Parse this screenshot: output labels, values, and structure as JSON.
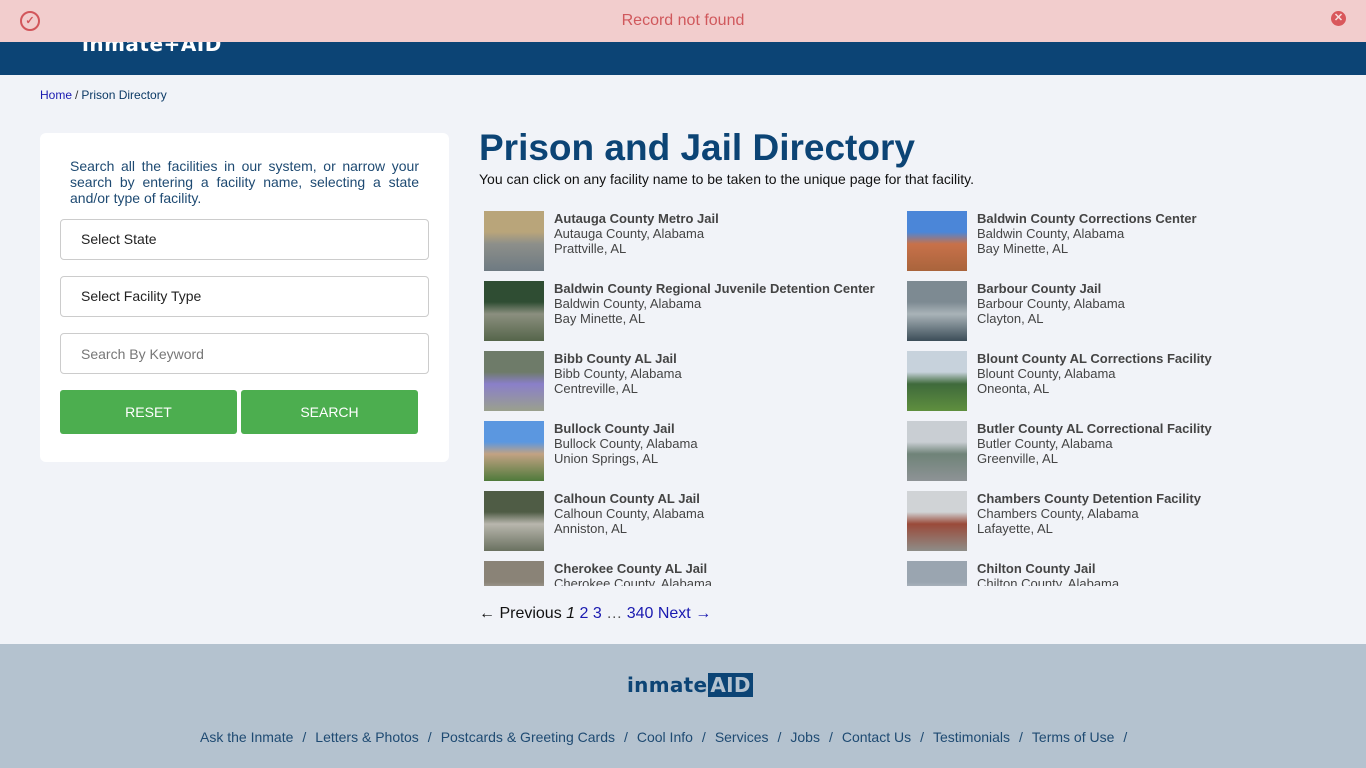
{
  "alert": {
    "message": "Record not found",
    "check_icon": "✓",
    "close_icon": "✕",
    "colors": {
      "background": "#f2cdcd",
      "text": "#d0585c"
    }
  },
  "header": {
    "logo_text": "inmate+AID",
    "background": "#0c4475"
  },
  "breadcrumb": {
    "home": "Home",
    "separator": "/",
    "current": "Prison Directory"
  },
  "search_panel": {
    "intro": "Search all the facilities in our system, or narrow your search by entering a facility name, selecting a state and/or type of facility.",
    "state_select": "Select State",
    "type_select": "Select Facility Type",
    "keyword_placeholder": "Search By Keyword",
    "keyword_value": "",
    "reset_label": "RESET",
    "search_label": "SEARCH",
    "button_color": "#4cae4f"
  },
  "main": {
    "title": "Prison and Jail Directory",
    "subtitle": "You can click on any facility name to be taken to the unique page for that facility.",
    "facilities": [
      {
        "name": "Autauga County Metro Jail",
        "county": "Autauga County, Alabama",
        "city": "Prattville, AL",
        "thumb_colors": [
          "#b9a57a",
          "#8d8f8a",
          "#6e7a82"
        ]
      },
      {
        "name": "Baldwin County Corrections Center",
        "county": "Baldwin County, Alabama",
        "city": "Bay Minette, AL",
        "thumb_colors": [
          "#4b86d8",
          "#c8714a",
          "#a9643c"
        ]
      },
      {
        "name": "Baldwin County Regional Juvenile Detention Center",
        "county": "Baldwin County, Alabama",
        "city": "Bay Minette, AL",
        "thumb_colors": [
          "#2f4d33",
          "#8b8f7f",
          "#55654a"
        ]
      },
      {
        "name": "Barbour County Jail",
        "county": "Barbour County, Alabama",
        "city": "Clayton, AL",
        "thumb_colors": [
          "#7d8a92",
          "#a9b3b8",
          "#3c4d58"
        ]
      },
      {
        "name": "Bibb County AL Jail",
        "county": "Bibb County, Alabama",
        "city": "Centreville, AL",
        "thumb_colors": [
          "#6e7b69",
          "#8a7fc9",
          "#9aa08d"
        ]
      },
      {
        "name": "Blount County AL Corrections Facility",
        "county": "Blount County, Alabama",
        "city": "Oneonta, AL",
        "thumb_colors": [
          "#c7d2dc",
          "#3f6a3c",
          "#5f8f3e"
        ]
      },
      {
        "name": "Bullock County Jail",
        "county": "Bullock County, Alabama",
        "city": "Union Springs, AL",
        "thumb_colors": [
          "#5b97e0",
          "#c2a283",
          "#4f7a3b"
        ]
      },
      {
        "name": "Butler County AL Correctional Facility",
        "county": "Butler County, Alabama",
        "city": "Greenville, AL",
        "thumb_colors": [
          "#c9ced3",
          "#6f8378",
          "#8e9396"
        ]
      },
      {
        "name": "Calhoun County AL Jail",
        "county": "Calhoun County, Alabama",
        "city": "Anniston, AL",
        "thumb_colors": [
          "#4f5c45",
          "#b8b6ad",
          "#6a7160"
        ]
      },
      {
        "name": "Chambers County Detention Facility",
        "county": "Chambers County, Alabama",
        "city": "Lafayette, AL",
        "thumb_colors": [
          "#d0d3d6",
          "#9a4a3a",
          "#8e8d88"
        ]
      },
      {
        "name": "Cherokee County AL Jail",
        "county": "Cherokee County, Alabama",
        "city": "",
        "thumb_colors": [
          "#8a8377",
          "#b5b1aa",
          "#5d5a52"
        ]
      },
      {
        "name": "Chilton County Jail",
        "county": "Chilton County, Alabama",
        "city": "",
        "thumb_colors": [
          "#9aa5b0",
          "#bfc6cc",
          "#6b6e68"
        ]
      }
    ]
  },
  "pagination": {
    "previous": "← Previous",
    "current": "1",
    "pages": [
      "2",
      "3"
    ],
    "ellipsis": "…",
    "last": "340",
    "next": "Next →"
  },
  "footer": {
    "logo_text_1": "inmate",
    "logo_text_2": "AID",
    "links": [
      "Ask the Inmate",
      "Letters & Photos",
      "Postcards & Greeting Cards",
      "Cool Info",
      "Services",
      "Jobs",
      "Contact Us",
      "Testimonials",
      "Terms of Use"
    ],
    "separator": "/",
    "background": "#b4c2cf"
  }
}
